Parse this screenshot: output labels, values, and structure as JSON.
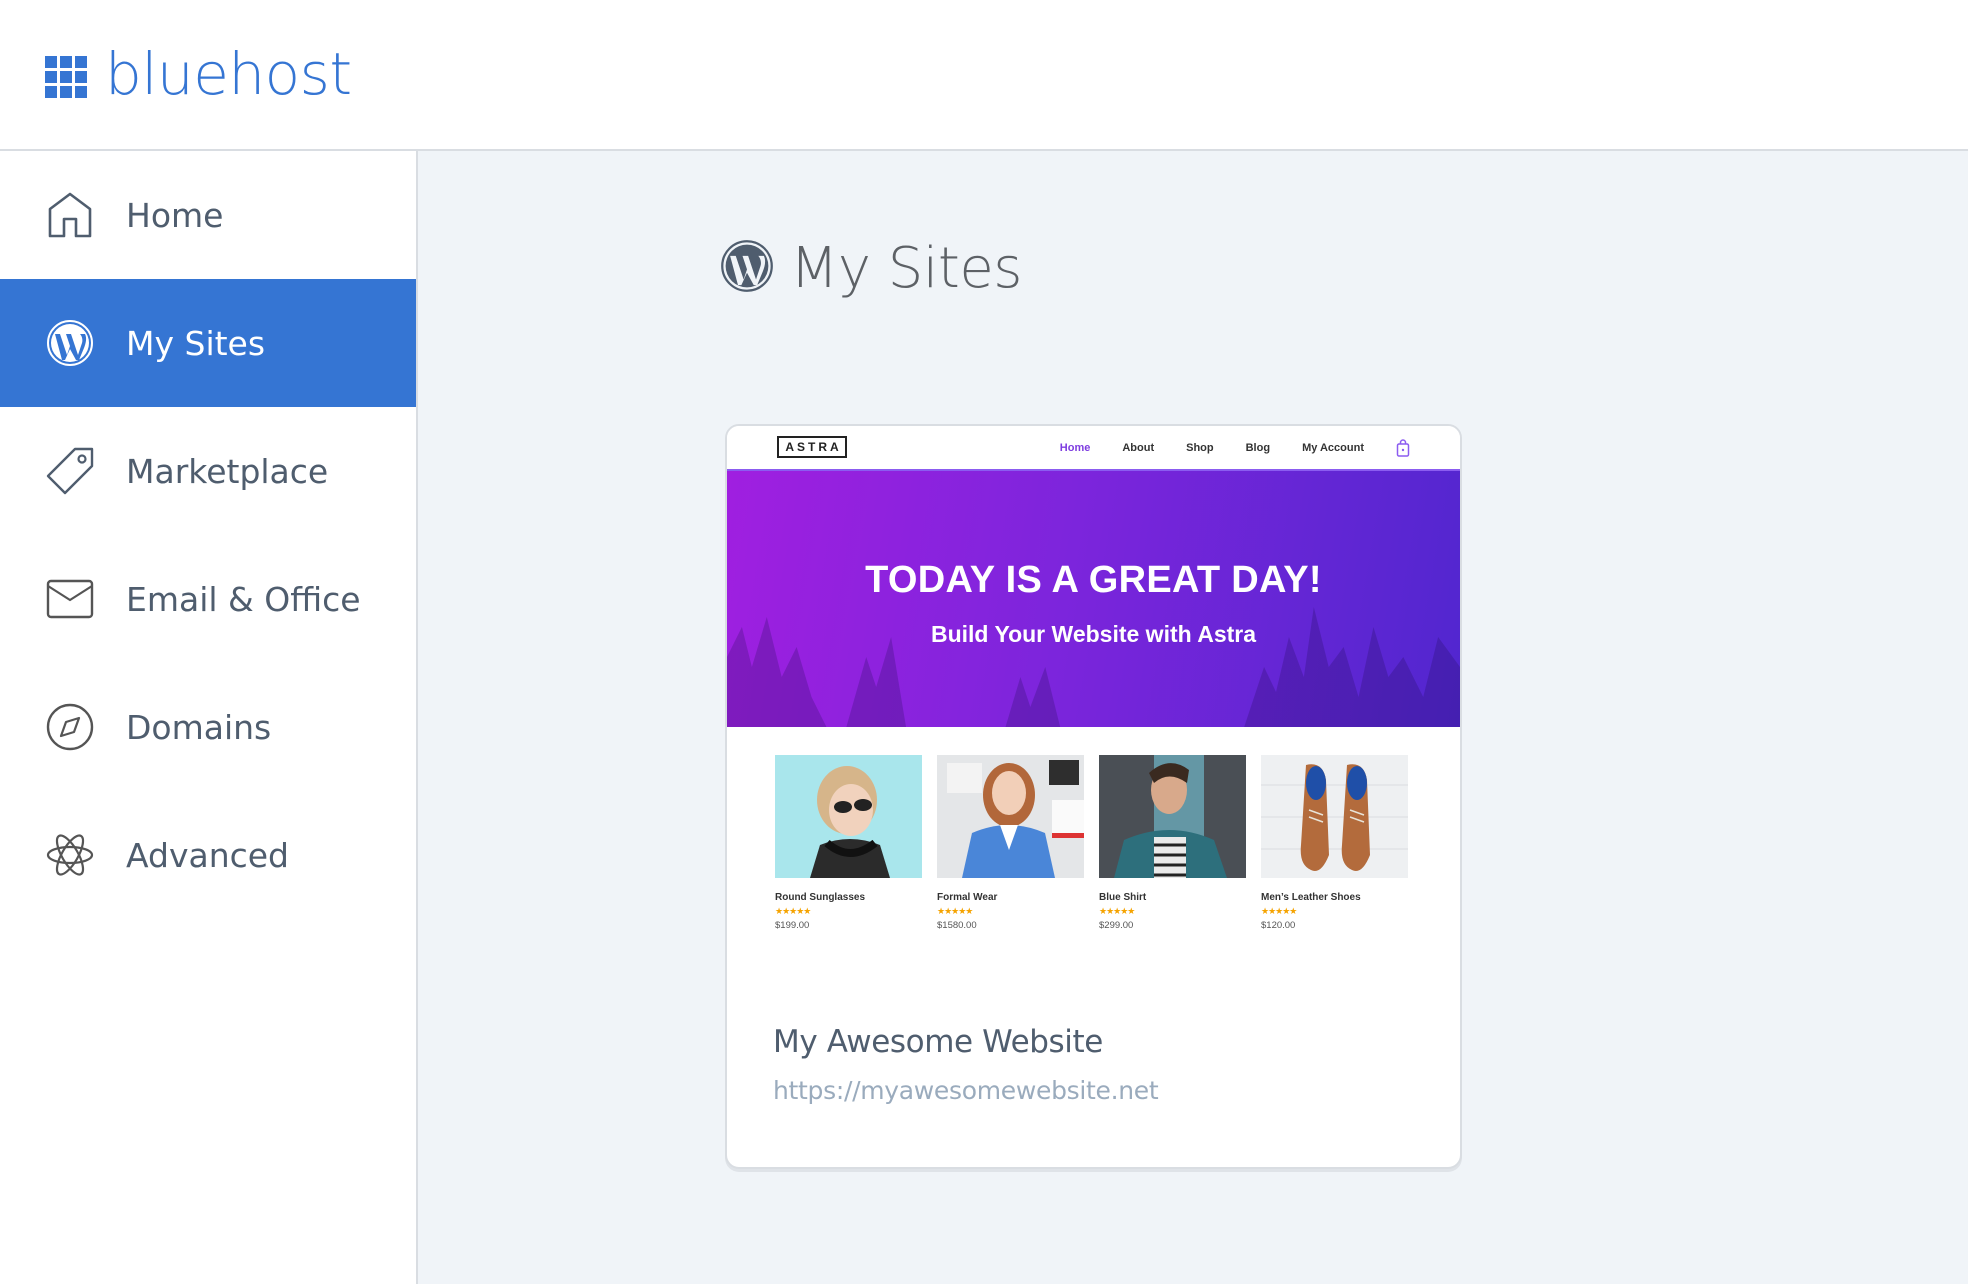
{
  "brand": {
    "name": "bluehost",
    "logo_icon": "grid-icon",
    "color": "#3575d3"
  },
  "sidebar": {
    "items": [
      {
        "label": "Home",
        "icon": "house-icon",
        "active": false
      },
      {
        "label": "My Sites",
        "icon": "wordpress-icon",
        "active": true
      },
      {
        "label": "Marketplace",
        "icon": "tag-icon",
        "active": false
      },
      {
        "label": "Email & Office",
        "icon": "envelope-icon",
        "active": false
      },
      {
        "label": "Domains",
        "icon": "compass-icon",
        "active": false
      },
      {
        "label": "Advanced",
        "icon": "atom-icon",
        "active": false
      }
    ]
  },
  "main": {
    "title": "My Sites",
    "title_icon": "wordpress-icon",
    "sites": [
      {
        "name": "My Awesome Website",
        "url": "https://myawesomewebsite.net",
        "preview": {
          "logo": "ASTRA",
          "menu": [
            "Home",
            "About",
            "Shop",
            "Blog",
            "My Account"
          ],
          "menu_current": "Home",
          "cart_icon": "shopping-bag-icon",
          "hero_title": "TODAY IS A GREAT DAY!",
          "hero_subtitle": "Build Your Website with Astra",
          "products": [
            {
              "name": "Round Sunglasses",
              "rating": 5,
              "stars": "★★★★★",
              "price": "$199.00"
            },
            {
              "name": "Formal Wear",
              "rating": 5,
              "stars": "★★★★★",
              "price": "$1580.00"
            },
            {
              "name": "Blue Shirt",
              "rating": 5,
              "stars": "★★★★★",
              "price": "$299.00"
            },
            {
              "name": "Men’s Leather Shoes",
              "rating": 5,
              "stars": "★★★★★",
              "price": "$120.00"
            }
          ]
        }
      }
    ]
  }
}
